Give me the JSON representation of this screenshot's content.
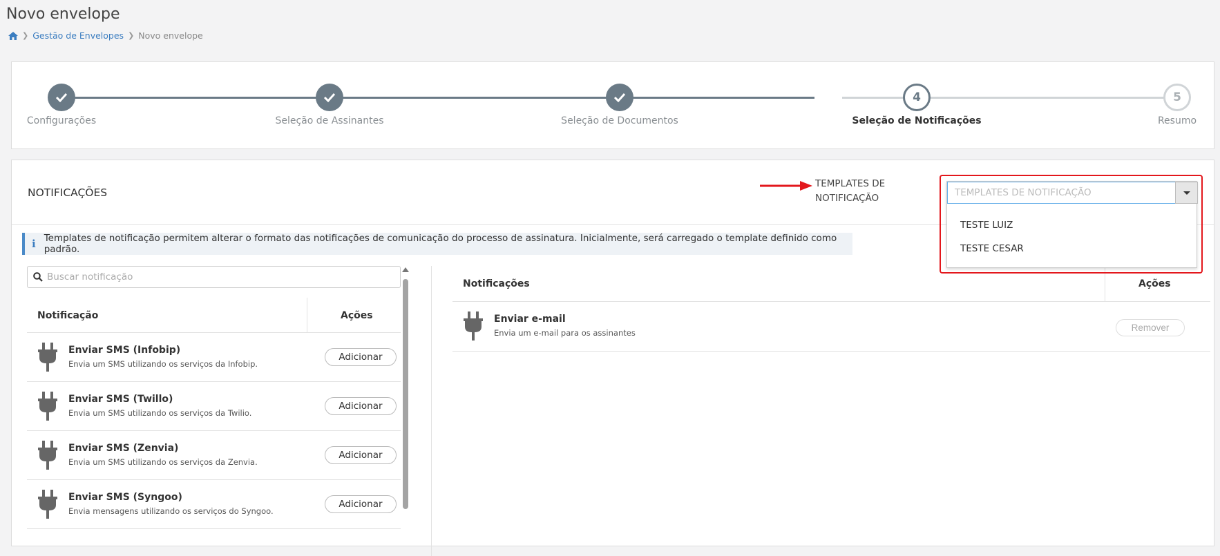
{
  "page": {
    "title": "Novo envelope"
  },
  "breadcrumb": {
    "home_icon": "home-icon",
    "items": [
      "Gestão de Envelopes",
      "Novo envelope"
    ]
  },
  "wizard": {
    "current_step": 4,
    "steps": [
      {
        "label": "Configurações",
        "status": "done",
        "icon": "check-icon"
      },
      {
        "label": "Seleção de Assinantes",
        "status": "done",
        "icon": "check-icon"
      },
      {
        "label": "Seleção de Documentos",
        "status": "done",
        "icon": "check-icon"
      },
      {
        "label": "Seleção de Notificações",
        "status": "active",
        "number": "4"
      },
      {
        "label": "Resumo",
        "status": "pending",
        "number": "5"
      }
    ]
  },
  "notifications_section": {
    "title": "NOTIFICAÇÕES",
    "templates_label": "TEMPLATES DE NOTIFICAÇÃO",
    "templates_placeholder": "TEMPLATES DE NOTIFICAÇÃO",
    "template_options": [
      "TESTE LUIZ",
      "TESTE CESAR"
    ],
    "info_text": "Templates de notificação permitem alterar o formato das notificações de comunicação do processo de assinatura. Inicialmente, será carregado o template definido como padrão."
  },
  "available": {
    "search_placeholder": "Buscar notificação",
    "col_notification": "Notificação",
    "col_actions": "Ações",
    "add_label": "Adicionar",
    "items": [
      {
        "title": "Enviar SMS (Infobip)",
        "description": "Envia um SMS utilizando os serviços da Infobip."
      },
      {
        "title": "Enviar SMS (Twillo)",
        "description": "Envia um SMS utilizando os serviços da Twilio."
      },
      {
        "title": "Enviar SMS (Zenvia)",
        "description": "Envia um SMS utilizando os serviços da Zenvia."
      },
      {
        "title": "Enviar SMS (Syngoo)",
        "description": "Envia mensagens utilizando os serviços do Syngoo."
      }
    ]
  },
  "selected": {
    "col_notification": "Notificações",
    "col_actions": "Ações",
    "remove_label": "Remover",
    "items": [
      {
        "title": "Enviar e-mail",
        "description": "Envia um e-mail para os assinantes"
      }
    ]
  },
  "colors": {
    "accent": "#3b7dc0",
    "step": "#6a7a86",
    "highlight": "#e3171c"
  }
}
